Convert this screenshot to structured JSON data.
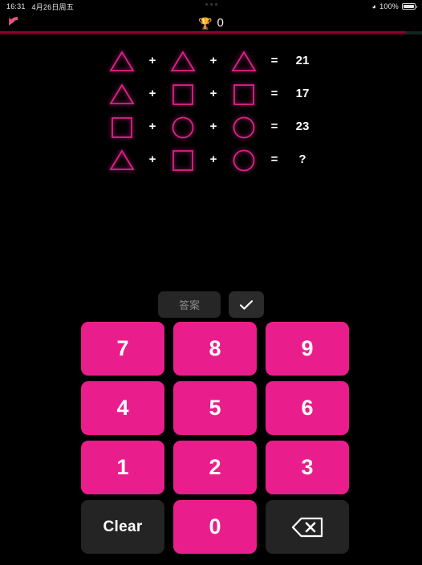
{
  "status_bar": {
    "time": "16:31",
    "date": "4月26日周五",
    "wifi_icon": "wifi-icon",
    "battery_percent": "100%",
    "battery_icon": "battery-icon"
  },
  "header": {
    "back_icon": "back-arrow-icon",
    "trophy_icon": "trophy-icon",
    "score": "0",
    "progress_percent": 96
  },
  "puzzle": {
    "equations": [
      {
        "terms": [
          "triangle",
          "triangle",
          "triangle"
        ],
        "ops": [
          "+",
          "+"
        ],
        "equals": "=",
        "result": "21"
      },
      {
        "terms": [
          "triangle",
          "square",
          "square"
        ],
        "ops": [
          "+",
          "+"
        ],
        "equals": "=",
        "result": "17"
      },
      {
        "terms": [
          "square",
          "circle",
          "circle"
        ],
        "ops": [
          "+",
          "+"
        ],
        "equals": "=",
        "result": "23"
      },
      {
        "terms": [
          "triangle",
          "square",
          "circle"
        ],
        "ops": [
          "+",
          "+"
        ],
        "equals": "=",
        "result": "?"
      }
    ]
  },
  "actions": {
    "answer_label": "答案",
    "check_icon": "checkmark-icon"
  },
  "keypad": {
    "keys": [
      {
        "label": "7",
        "name": "key-7",
        "style": "num"
      },
      {
        "label": "8",
        "name": "key-8",
        "style": "num"
      },
      {
        "label": "9",
        "name": "key-9",
        "style": "num"
      },
      {
        "label": "4",
        "name": "key-4",
        "style": "num"
      },
      {
        "label": "5",
        "name": "key-5",
        "style": "num"
      },
      {
        "label": "6",
        "name": "key-6",
        "style": "num"
      },
      {
        "label": "1",
        "name": "key-1",
        "style": "num"
      },
      {
        "label": "2",
        "name": "key-2",
        "style": "num"
      },
      {
        "label": "3",
        "name": "key-3",
        "style": "num"
      },
      {
        "label": "Clear",
        "name": "key-clear",
        "style": "clear"
      },
      {
        "label": "0",
        "name": "key-0",
        "style": "num"
      },
      {
        "label": "",
        "name": "key-backspace",
        "style": "backspace",
        "icon": "backspace-icon"
      }
    ]
  },
  "colors": {
    "accent_pink": "#e91e8c",
    "shape_outline": "#e0218a",
    "background": "#000000",
    "key_dark": "#242424",
    "progress_fill": "#7d0026"
  }
}
